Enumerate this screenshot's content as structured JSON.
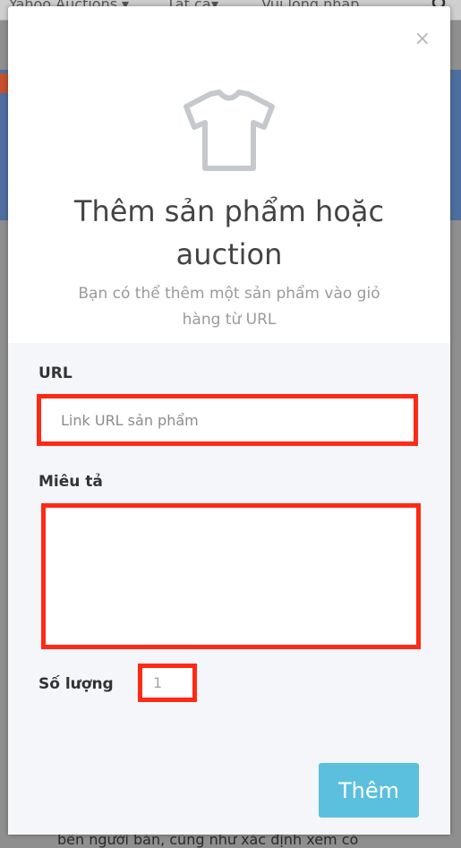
{
  "background": {
    "store_select": "Yahoo Auctions",
    "category_select": "Tất cả",
    "search_placeholder": "Vui lòng nhập",
    "footer_text": "bên người bán, cũng như xác định xem có"
  },
  "modal": {
    "close_label": "×",
    "icon": "tshirt-icon",
    "title": "Thêm sản phẩm hoặc auction",
    "subtitle": "Bạn có thể thêm một sản phẩm vào giỏ hàng từ URL",
    "url": {
      "label": "URL",
      "placeholder": "Link URL sản phẩm",
      "value": ""
    },
    "description": {
      "label": "Miêu tả",
      "value": ""
    },
    "quantity": {
      "label": "Số lượng",
      "value": "1"
    },
    "submit_label": "Thêm"
  },
  "colors": {
    "accent": "#5bc0de",
    "highlight": "#ff2a16",
    "form_background": "#f5f6f9"
  }
}
